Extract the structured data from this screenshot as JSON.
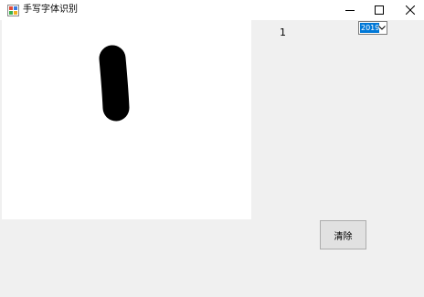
{
  "window": {
    "title": "手写字体识别",
    "buttons": {
      "minimize": "minimize-icon",
      "maximize": "maximize-icon",
      "close": "close-icon"
    }
  },
  "canvas": {
    "background": "#ffffff",
    "stroke_color": "#000000"
  },
  "result": {
    "value": "1"
  },
  "model_select": {
    "selected": "2019",
    "highlight_color": "#0078d7"
  },
  "clear_button": {
    "label": "清除"
  }
}
